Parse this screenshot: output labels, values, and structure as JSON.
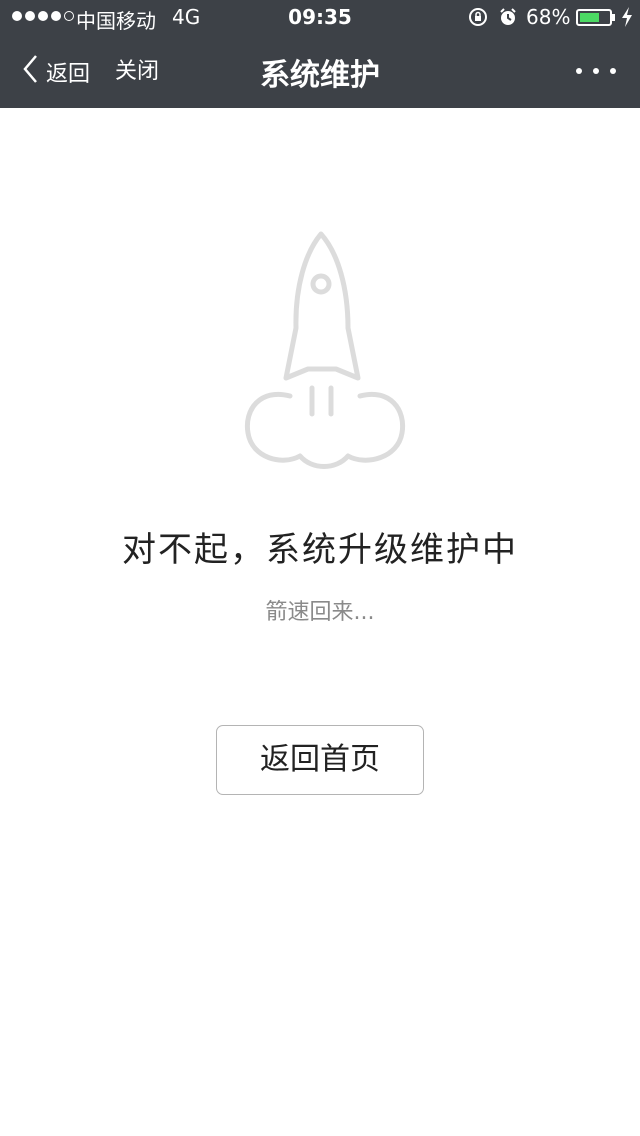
{
  "status_bar": {
    "carrier": "中国移动",
    "network": "4G",
    "time": "09:35",
    "battery_percent": "68%",
    "battery_level": 0.68,
    "signal_bars_filled": 4,
    "signal_bars_total": 5,
    "battery_color": "#4cd964",
    "icons": [
      "orientation-lock-icon",
      "alarm-icon",
      "charging-icon"
    ]
  },
  "nav": {
    "back_label": "返回",
    "close_label": "关闭",
    "title": "系统维护",
    "more_icon": "more-icon",
    "background": "#3d4147"
  },
  "main": {
    "illustration": "rocket-icon",
    "headline": "对不起，系统升级维护中",
    "subtext": "箭速回来...",
    "home_button_label": "返回首页"
  }
}
